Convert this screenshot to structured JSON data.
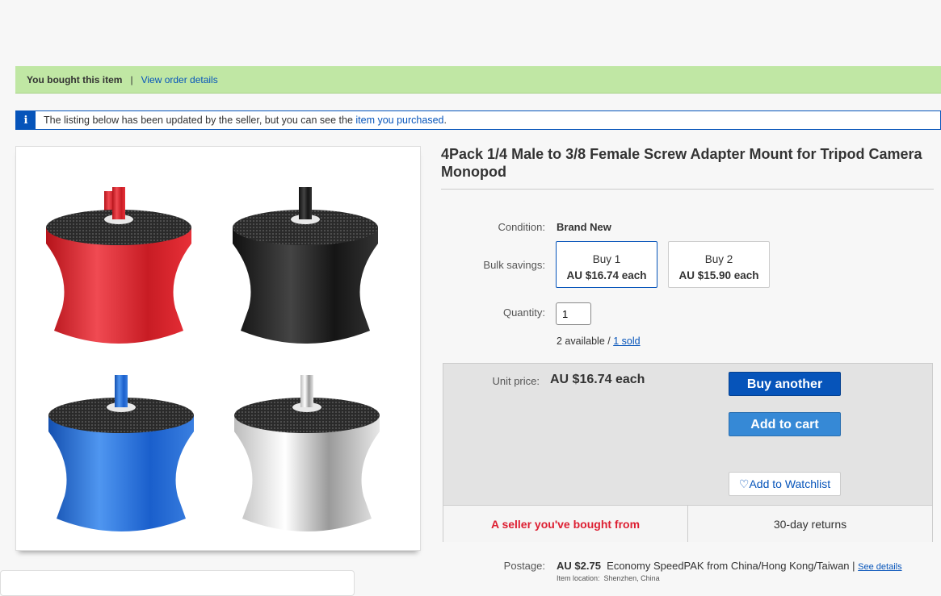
{
  "order_banner": {
    "text": "You bought this item",
    "separator": "|",
    "link": "View order details"
  },
  "info_banner": {
    "icon": "i",
    "text": "The listing below has been updated by the seller, but you can see the ",
    "link": "item you purchased",
    "suffix": "."
  },
  "product": {
    "title": "4Pack 1/4 Male to 3/8 Female Screw Adapter Mount for Tripod Camera Monopod",
    "image_colors": [
      "#d9232b",
      "#1f1f1f",
      "#1f63c9",
      "#d4d4d4"
    ]
  },
  "details": {
    "condition_label": "Condition:",
    "condition_value": "Brand New",
    "bulk_label": "Bulk savings:",
    "bulk_options": [
      {
        "qty": "Buy 1",
        "price": "AU $16.74 each",
        "selected": true
      },
      {
        "qty": "Buy 2",
        "price": "AU $15.90 each",
        "selected": false
      }
    ],
    "quantity_label": "Quantity:",
    "quantity_value": "1",
    "available": "2 available / ",
    "sold": "1 sold"
  },
  "buy_box": {
    "unit_price_label": "Unit price:",
    "unit_price": "AU $16.74 each",
    "buy_another": "Buy another",
    "add_to_cart": "Add to cart",
    "watchlist": "Add to Watchlist",
    "seller_note": "A seller you've bought from",
    "returns": "30-day returns"
  },
  "postage": {
    "label": "Postage:",
    "price": "AU $2.75",
    "service": "Economy SpeedPAK from China/Hong Kong/Taiwan |",
    "details_link": "See details",
    "location_label": "Item location:",
    "location": "Shenzhen, China"
  },
  "colors": {
    "link_blue": "#0654ba",
    "banner_green": "#c0e7a4",
    "cart_blue": "#3689d6",
    "seller_red": "#dd1e31"
  }
}
